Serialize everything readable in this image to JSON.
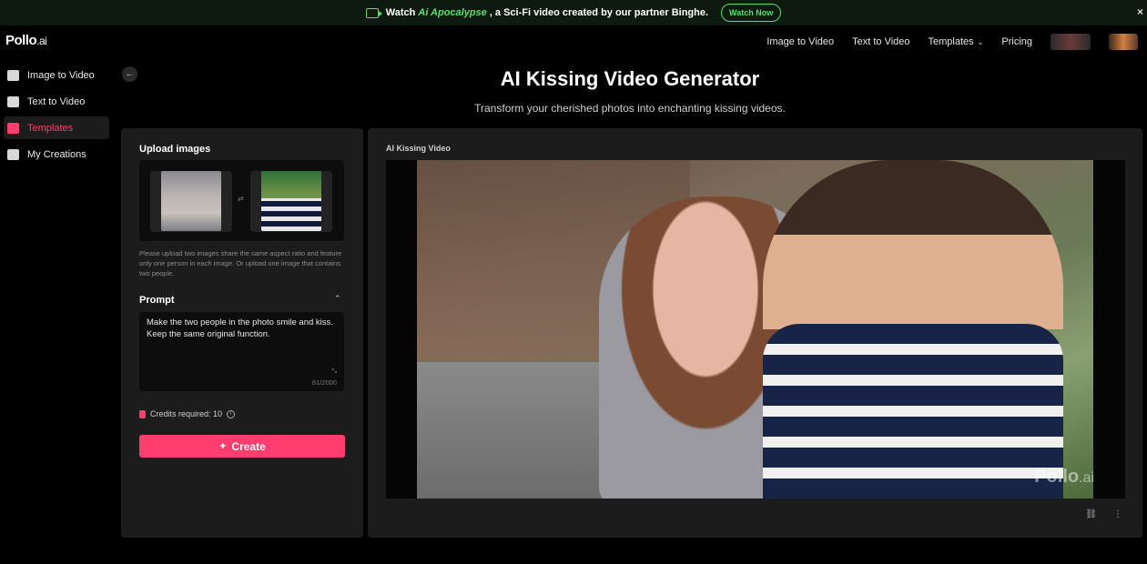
{
  "banner": {
    "pre": "Watch",
    "title": "Ai Apocalypse",
    "post": ", a Sci-Fi video created by our partner Binghe.",
    "watch_label": "Watch Now",
    "close": "×"
  },
  "logo": {
    "main": "Pollo",
    "suffix": ".ai"
  },
  "nav": {
    "image_to_video": "Image to Video",
    "text_to_video": "Text to Video",
    "templates": "Templates",
    "pricing": "Pricing"
  },
  "sidebar": {
    "items": [
      {
        "label": "Image to Video",
        "icon": "image-video-icon"
      },
      {
        "label": "Text to Video",
        "icon": "text-video-icon"
      },
      {
        "label": "Templates",
        "icon": "templates-icon",
        "active": true
      },
      {
        "label": "My Creations",
        "icon": "creations-icon"
      }
    ]
  },
  "page": {
    "title": "AI Kissing Video Generator",
    "subtitle": "Transform your cherished photos into enchanting kissing videos."
  },
  "left": {
    "upload_title": "Upload images",
    "hint": "Please upload two images share the same aspect ratio and feature only one person in each image. Or upload one image that contains two people.",
    "prompt_title": "Prompt",
    "prompt_text": "Make the two people in the photo smile and kiss. Keep the same original function.",
    "prompt_count": "81/2000",
    "credits": "Credits required: 10",
    "create_label": "Create"
  },
  "right": {
    "title": "AI Kissing Video",
    "watermark_main": "Pollo",
    "watermark_suffix": ".ai"
  },
  "colors": {
    "accent": "#ff3d6e",
    "banner_green": "#58e06b",
    "panel": "#1c1c1c"
  }
}
